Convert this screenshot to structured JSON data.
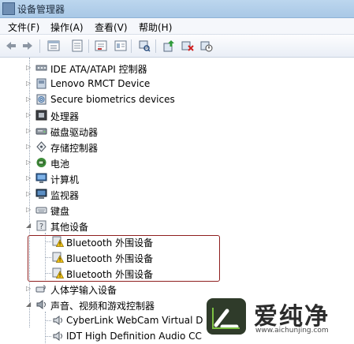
{
  "window": {
    "title": "设备管理器"
  },
  "menu": [
    "文件(F)",
    "操作(A)",
    "查看(V)",
    "帮助(H)"
  ],
  "toolbar": [
    "back-arrow-icon",
    "forward-arrow-icon",
    "properties-icon",
    "help-icon",
    "scan-icon",
    "update-driver-icon",
    "uninstall-icon",
    "disable-icon"
  ],
  "tree": {
    "items": [
      {
        "label": "IDE ATA/ATAPI 控制器",
        "icon": "ide-controller-icon",
        "expand": "▷"
      },
      {
        "label": "Lenovo RMCT Device",
        "icon": "device-icon",
        "expand": "▷"
      },
      {
        "label": "Secure biometrics devices",
        "icon": "biometric-icon",
        "expand": "▷"
      },
      {
        "label": "处理器",
        "icon": "processor-icon",
        "expand": "▷"
      },
      {
        "label": "磁盘驱动器",
        "icon": "disk-icon",
        "expand": "▷"
      },
      {
        "label": "存储控制器",
        "icon": "storage-controller-icon",
        "expand": "▷"
      },
      {
        "label": "电池",
        "icon": "battery-icon",
        "expand": "▷"
      },
      {
        "label": "计算机",
        "icon": "computer-icon",
        "expand": "▷"
      },
      {
        "label": "监视器",
        "icon": "monitor-icon",
        "expand": "▷"
      },
      {
        "label": "键盘",
        "icon": "keyboard-icon",
        "expand": "▷"
      },
      {
        "label": "其他设备",
        "icon": "other-devices-icon",
        "expand": "◢"
      },
      {
        "label": "Bluetooth 外围设备",
        "icon": "warning-device-icon",
        "expand": ""
      },
      {
        "label": "Bluetooth 外围设备",
        "icon": "warning-device-icon",
        "expand": ""
      },
      {
        "label": "Bluetooth 外围设备",
        "icon": "warning-device-icon",
        "expand": ""
      },
      {
        "label": "人体学输入设备",
        "icon": "hid-icon",
        "expand": "▷"
      },
      {
        "label": "声音、视频和游戏控制器",
        "icon": "sound-icon",
        "expand": "◢"
      },
      {
        "label": "CyberLink WebCam Virtual D",
        "icon": "audio-device-icon",
        "expand": ""
      },
      {
        "label": "IDT High Definition Audio CC",
        "icon": "audio-device-icon",
        "expand": ""
      }
    ]
  },
  "watermark": {
    "brand": "爱纯净",
    "url": "www.aichunjing.com"
  },
  "colors": {
    "highlight_border": "#8f1f1f",
    "titlebar": "#bcd6ee"
  }
}
